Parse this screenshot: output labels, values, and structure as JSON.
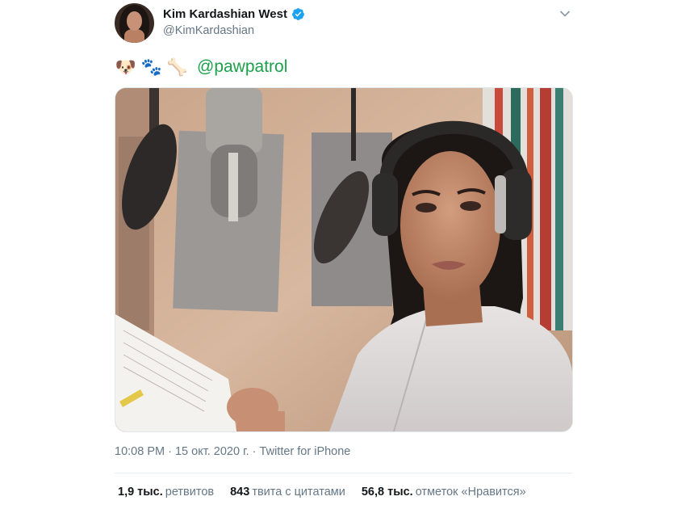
{
  "author": {
    "display_name": "Kim Kardashian West",
    "handle": "@KimKardashian",
    "avatar_icon": "profile-photo",
    "verified_icon": "verified-badge-icon",
    "verified_color": "#1da1f2"
  },
  "tweet": {
    "emojis": [
      "🐶",
      "🐾",
      "🦴"
    ],
    "mention": "@pawpatrol",
    "mention_color": "#1aa14a"
  },
  "meta": {
    "time": "10:08 PM",
    "separator": "·",
    "date": "15 окт. 2020 г.",
    "source": "Twitter for iPhone"
  },
  "stats": [
    {
      "count": "1,9 тыс.",
      "label": "ретвитов"
    },
    {
      "count": "843",
      "label": "твита с цитатами"
    },
    {
      "count": "56,8 тыс.",
      "label": "отметок «Нравится»"
    }
  ],
  "colors": {
    "text_primary": "#14171a",
    "text_secondary": "#657786",
    "divider": "#e6ecf0"
  }
}
